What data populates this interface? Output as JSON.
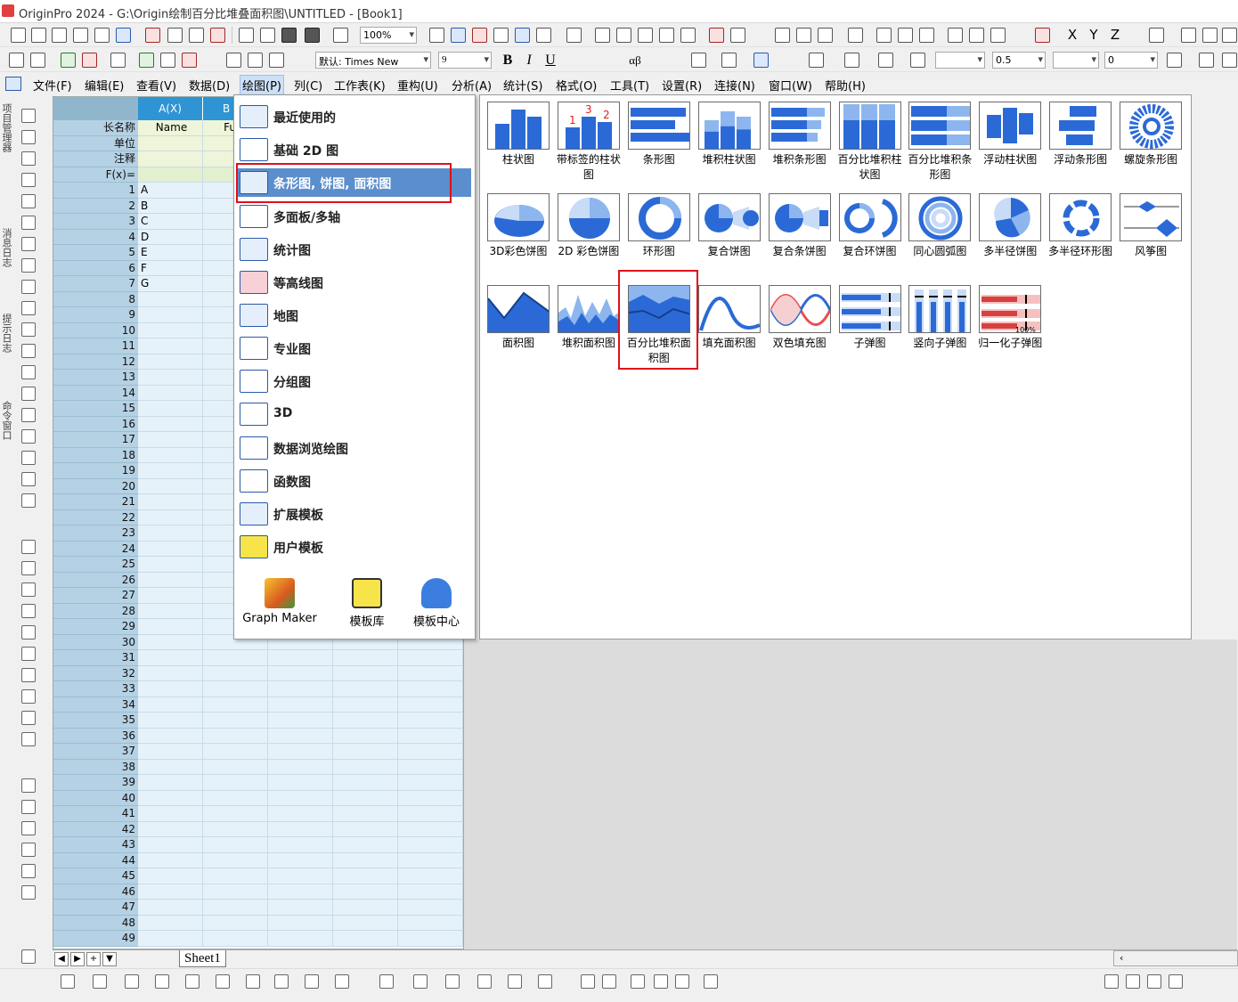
{
  "window": {
    "title": "OriginPro 2024 - G:\\Origin绘制百分比堆叠面积图\\UNTITLED - [Book1]"
  },
  "toolbar": {
    "zoom": "100%",
    "font_name": "默认: Times New",
    "font_size": "9",
    "bold": "B",
    "italic": "I",
    "underline": "U",
    "greek": "αβ",
    "line_width": "0.5",
    "offset": "0"
  },
  "axis_buttons": {
    "x": "X",
    "y": "Y",
    "z": "Z"
  },
  "menubar": [
    "文件(F)",
    "编辑(E)",
    "查看(V)",
    "数据(D)",
    "绘图(P)",
    "列(C)",
    "工作表(K)",
    "重构(U)",
    "分析(A)",
    "统计(S)",
    "格式(O)",
    "工具(T)",
    "设置(R)",
    "连接(N)",
    "窗口(W)",
    "帮助(H)"
  ],
  "left_toolbar_labels": [
    "项目管理器",
    "消息日志",
    "提示日志",
    "命令窗口"
  ],
  "worksheet": {
    "row_labels": [
      "长名称",
      "单位",
      "注释",
      "F(x)="
    ],
    "columns": [
      {
        "header": "A(X)",
        "long_name": "Name"
      },
      {
        "header": "B",
        "long_name": "Fu"
      }
    ],
    "rows": [
      "A",
      "B",
      "C",
      "D",
      "E",
      "F",
      "G"
    ],
    "row_count": 49,
    "sheet_tab": "Sheet1"
  },
  "plot_menu": {
    "categories": [
      "最近使用的",
      "基础 2D 图",
      "条形图, 饼图, 面积图",
      "多面板/多轴",
      "统计图",
      "等高线图",
      "地图",
      "专业图",
      "分组图",
      "3D",
      "数据浏览绘图",
      "函数图",
      "扩展模板",
      "用户模板"
    ],
    "selected_category": "条形图, 饼图, 面积图",
    "bottom": [
      "Graph Maker",
      "模板库",
      "模板中心"
    ]
  },
  "gallery": {
    "row1": [
      "柱状图",
      "带标签的柱状图",
      "条形图",
      "堆积柱状图",
      "堆积条形图",
      "百分比堆积柱状图",
      "百分比堆积条形图",
      "浮动柱状图",
      "浮动条形图",
      "螺旋条形图"
    ],
    "row2": [
      "3D彩色饼图",
      "2D 彩色饼图",
      "环形图",
      "复合饼图",
      "复合条饼图",
      "复合环饼图",
      "同心圆弧图",
      "多半径饼图",
      "多半径环形图",
      "风筝图"
    ],
    "row3": [
      "面积图",
      "堆积面积图",
      "百分比堆积面积图",
      "填充面积图",
      "双色填充图",
      "子弹图",
      "竖向子弹图",
      "归一化子弹图"
    ],
    "highlighted": "百分比堆积面积图",
    "icon_text": {
      "labelled_bar_digits": [
        "1",
        "3",
        "2"
      ],
      "normalized_bullet": "100%"
    }
  },
  "colors": {
    "accent": "#2b6ad6",
    "highlight_box": "#e0101a",
    "menu_selected": "#5b8ecc",
    "column_header": "#2e94d3"
  }
}
